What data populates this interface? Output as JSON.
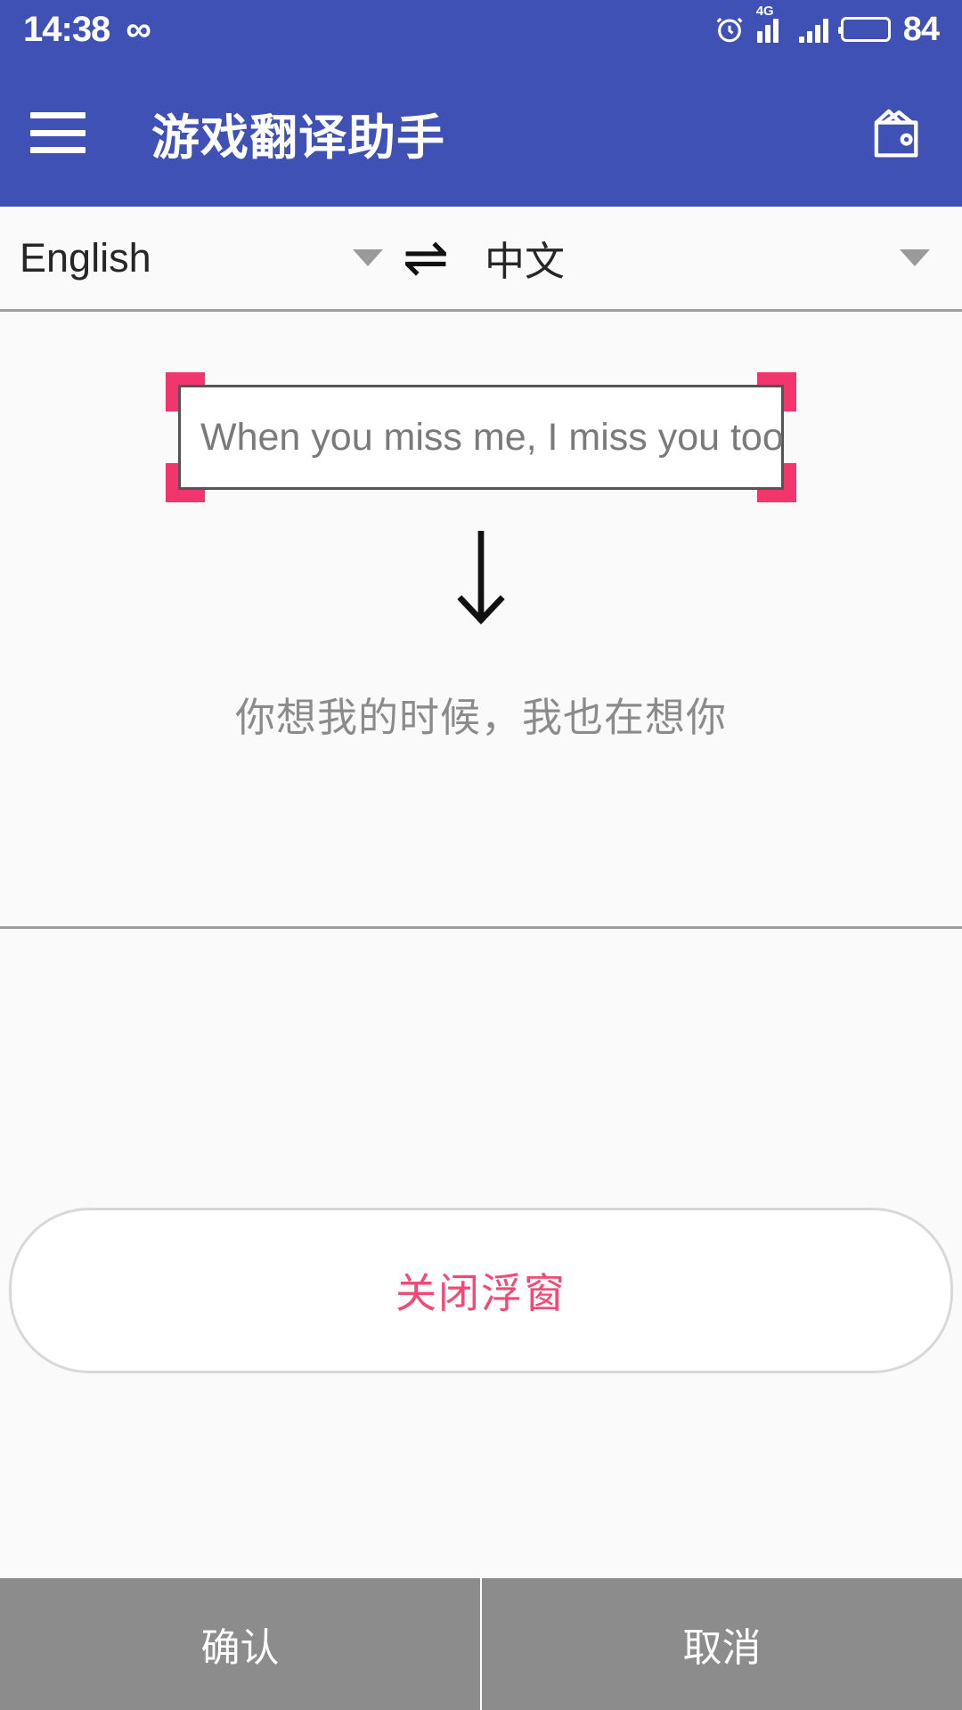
{
  "status_bar": {
    "time": "14:38",
    "infinity_glyph": "∞",
    "network_label": "4G",
    "battery_percent": "84",
    "icons": [
      "infinity-icon",
      "alarm-clock-icon",
      "signal-4g-icon",
      "signal-icon",
      "battery-icon"
    ]
  },
  "app_bar": {
    "title": "游戏翻译助手",
    "menu_icon": "hamburger-menu-icon",
    "right_icon": "wallet-icon",
    "background_color": "#3f51b5"
  },
  "language_row": {
    "source_language": "English",
    "target_language": "中文",
    "swap_glyph": "⇌"
  },
  "capture": {
    "selected_text": "When you miss me, I miss you too",
    "arrow_glyph": "↓",
    "handle_color": "#f2356d"
  },
  "translation": {
    "result_text": "你想我的时候，我也在想你"
  },
  "close_float": {
    "label": "关闭浮窗",
    "color": "#f24a74"
  },
  "bottom_bar": {
    "confirm_label": "确认",
    "cancel_label": "取消"
  }
}
